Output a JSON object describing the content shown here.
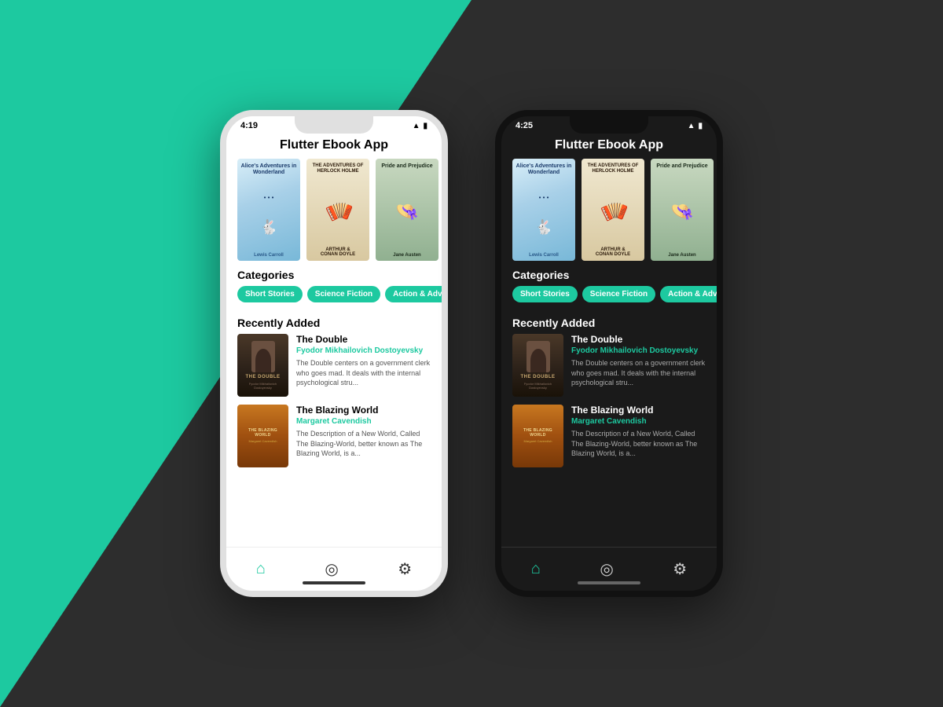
{
  "background": {
    "teal": "#1dc9a0",
    "dark": "#2d2d2d"
  },
  "phones": [
    {
      "id": "light",
      "theme": "light",
      "status": {
        "time": "4:19",
        "wifi": "wifi",
        "battery": "battery"
      },
      "app_title": "Flutter Ebook App",
      "categories_label": "Categories",
      "recently_added_label": "Recently Added",
      "categories": [
        "Short Stories",
        "Science Fiction",
        "Action & Adventure"
      ],
      "books_carousel": [
        {
          "title": "Alice's Adventures in Wonderland",
          "author": "Lewis Carroll"
        },
        {
          "title": "THE ADVENTURES OF SHERLOCK HOLME",
          "author": "ARTHUR & CONAN DOYLE"
        },
        {
          "title": "Pride and Prejudice",
          "author": "Jane Austen"
        }
      ],
      "recently_added": [
        {
          "title": "The Double",
          "author": "Fyodor Mikhailovich Dostoyevsky",
          "description": "The Double centers on a government clerk who goes mad. It deals with the internal psychological stru..."
        },
        {
          "title": "The Blazing World",
          "author": "Margaret Cavendish",
          "description": "The Description of a New World, Called The Blazing-World, better known as The Blazing World, is a..."
        }
      ],
      "nav": [
        "home",
        "compass",
        "settings"
      ]
    },
    {
      "id": "dark",
      "theme": "dark",
      "status": {
        "time": "4:25",
        "wifi": "wifi",
        "battery": "battery"
      },
      "app_title": "Flutter Ebook App",
      "categories_label": "Categories",
      "recently_added_label": "Recently Added",
      "categories": [
        "Short Stories",
        "Science Fiction",
        "Action & Adventure"
      ],
      "books_carousel": [
        {
          "title": "Alice's Adventures in Wonderland",
          "author": "Lewis Carroll"
        },
        {
          "title": "THE ADVENTURES OF SHERLOCK HOLME",
          "author": "ARTHUR & CONAN DOYLE"
        },
        {
          "title": "Pride and Prejudice",
          "author": "Jane Austen"
        }
      ],
      "recently_added": [
        {
          "title": "The Double",
          "author": "Fyodor Mikhailovich Dostoyevsky",
          "description": "The Double centers on a government clerk who goes mad. It deals with the internal psychological stru..."
        },
        {
          "title": "The Blazing World",
          "author": "Margaret Cavendish",
          "description": "The Description of a New World, Called The Blazing-World, better known as The Blazing World, is a..."
        }
      ],
      "nav": [
        "home",
        "compass",
        "settings"
      ]
    }
  ]
}
